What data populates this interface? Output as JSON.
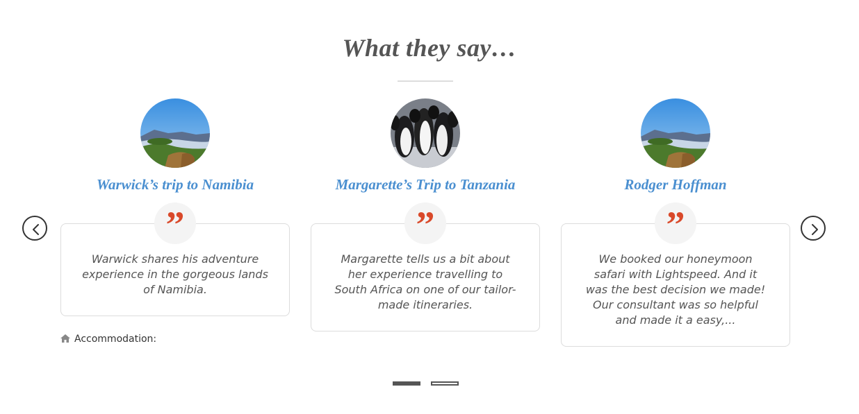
{
  "section": {
    "title": "What they say…"
  },
  "testimonials": [
    {
      "title": "Warwick’s trip to Namibia",
      "quote": "Warwick shares his adventure experience in the gorgeous lands of Namibia.",
      "image": "mountain-landscape-photo"
    },
    {
      "title": "Margarette’s Trip to Tanzania",
      "quote": "Margarette tells us a bit about her experience travelling to South Africa on one of our tailor-made itineraries.",
      "image": "penguins-photo"
    },
    {
      "title": "Rodger Hoffman",
      "quote": "We booked our honeymoon safari with Lightspeed. And it was the best decision we made! Our consultant was so helpful and made it a easy,...",
      "image": "mountain-landscape-photo"
    }
  ],
  "accommodation": {
    "label": "Accommodation:",
    "icon": "home-icon"
  },
  "navigation": {
    "prev_icon": "chevron-left-icon",
    "next_icon": "chevron-right-icon"
  },
  "pagination": {
    "current_page": 1,
    "total_pages": 2
  },
  "colors": {
    "title": "#555555",
    "card_title": "#4a8fd0",
    "quote_mark": "#d9492a",
    "border": "#dcdcdc"
  },
  "quote_glyph": "”"
}
